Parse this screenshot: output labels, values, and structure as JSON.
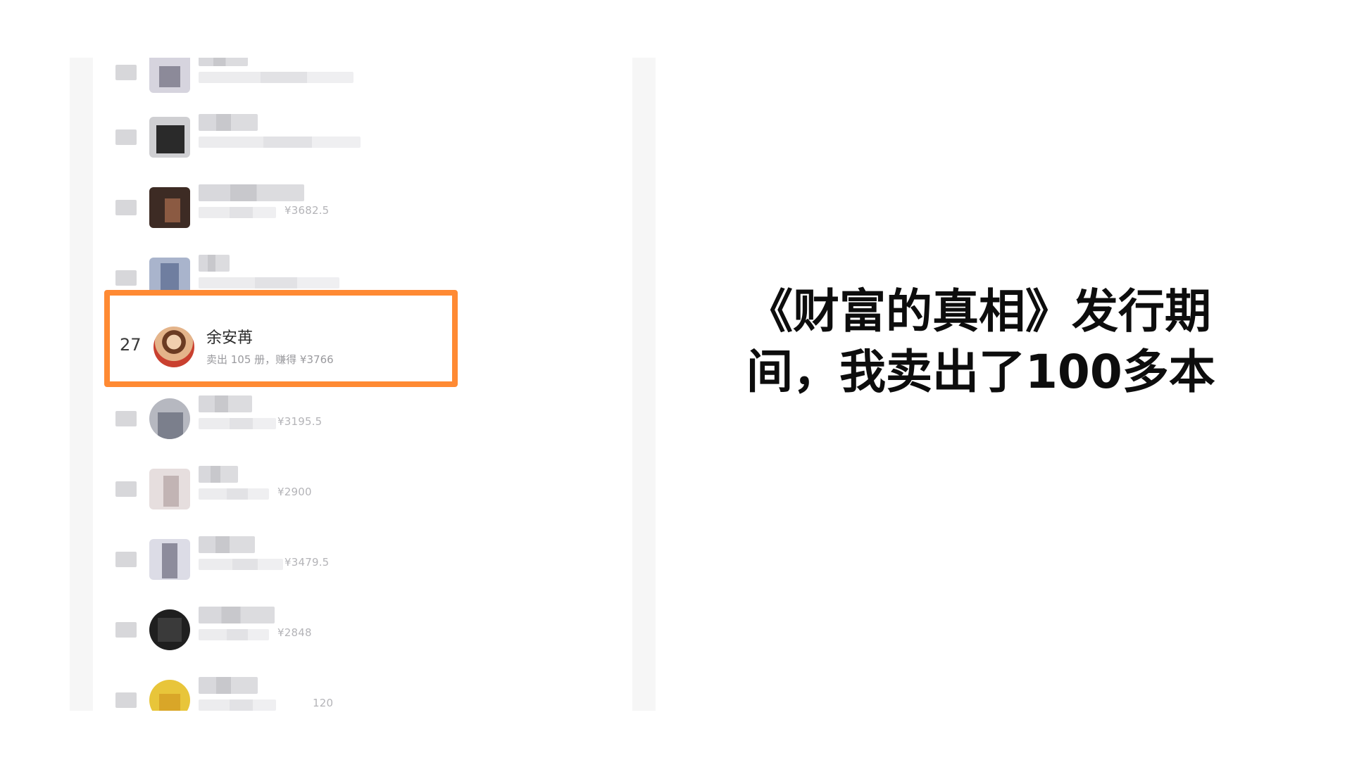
{
  "caption": {
    "line1": "《财富的真相》发行期",
    "line2": "间，我卖出了100多本"
  },
  "leaderboard": {
    "highlighted": {
      "rank": "27",
      "name": "余安苒",
      "stats": "卖出 105 册，赚得 ¥3766"
    },
    "visible_partial_earnings": [
      "¥3682.5",
      "¥3195.5",
      "¥2900",
      "¥3479.5",
      "¥2848",
      "120"
    ]
  },
  "colors": {
    "highlight_border": "#ff8a33",
    "panel_bg": "#f6f6f6",
    "text_dark": "#0d0d0d"
  }
}
